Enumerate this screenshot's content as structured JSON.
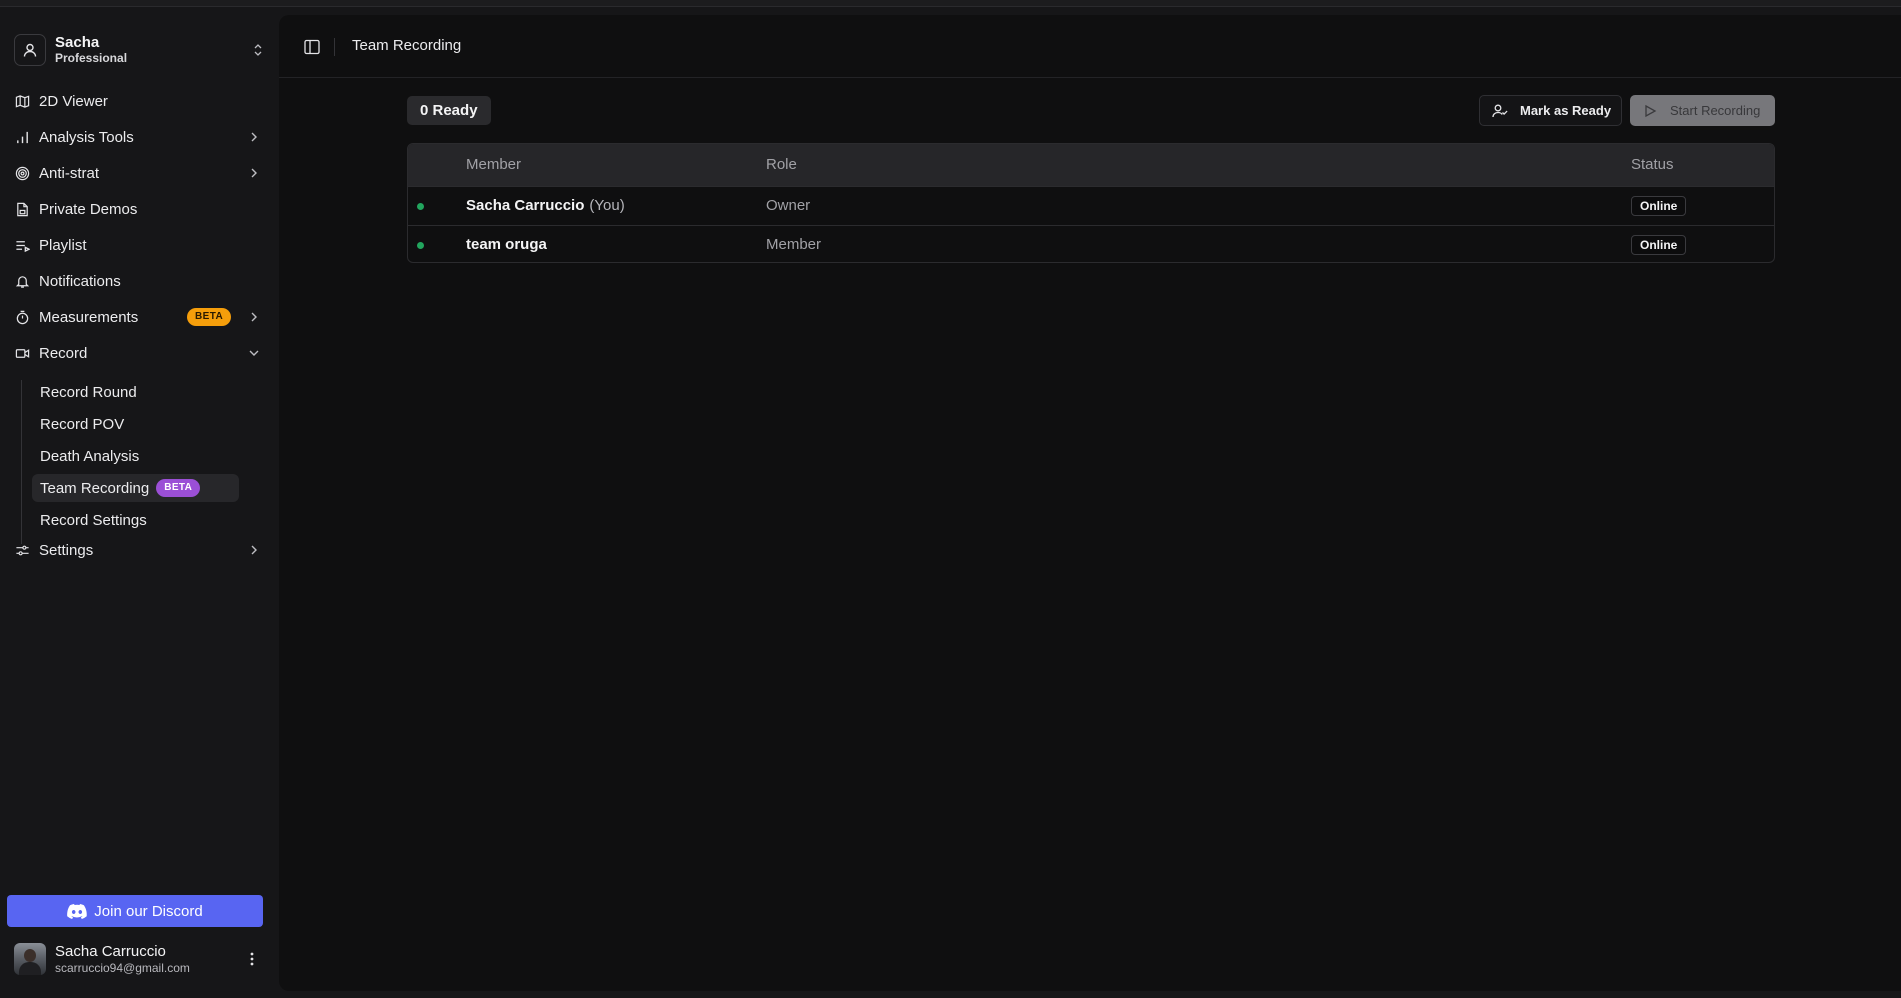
{
  "profile": {
    "name": "Sacha",
    "plan": "Professional"
  },
  "nav": {
    "viewer": "2D Viewer",
    "analysis_tools": "Analysis Tools",
    "anti_strat": "Anti-strat",
    "private_demos": "Private Demos",
    "playlist": "Playlist",
    "notifications": "Notifications",
    "measurements": "Measurements",
    "measurements_badge": "BETA",
    "record": "Record",
    "settings": "Settings"
  },
  "record_sub": {
    "record_round": "Record Round",
    "record_pov": "Record POV",
    "death_analysis": "Death Analysis",
    "team_recording": "Team Recording",
    "team_recording_badge": "BETA",
    "record_settings": "Record Settings"
  },
  "discord": {
    "label": "Join our Discord"
  },
  "user": {
    "name": "Sacha Carruccio",
    "email": "scarruccio94@gmail.com"
  },
  "header": {
    "title": "Team Recording"
  },
  "toolbar": {
    "ready_count": "0 Ready",
    "mark_ready": "Mark as Ready",
    "start_recording": "Start Recording"
  },
  "table": {
    "headers": {
      "member": "Member",
      "role": "Role",
      "status": "Status"
    },
    "rows": [
      {
        "member": "Sacha Carruccio",
        "suffix": "(You)",
        "role": "Owner",
        "status": "Online"
      },
      {
        "member": "team oruga",
        "suffix": "",
        "role": "Member",
        "status": "Online"
      }
    ]
  },
  "colors": {
    "accent_discord": "#5865f2",
    "beta_orange": "#f59e0b",
    "beta_purple": "#9b4fd6",
    "online_dot": "#22a55e"
  }
}
